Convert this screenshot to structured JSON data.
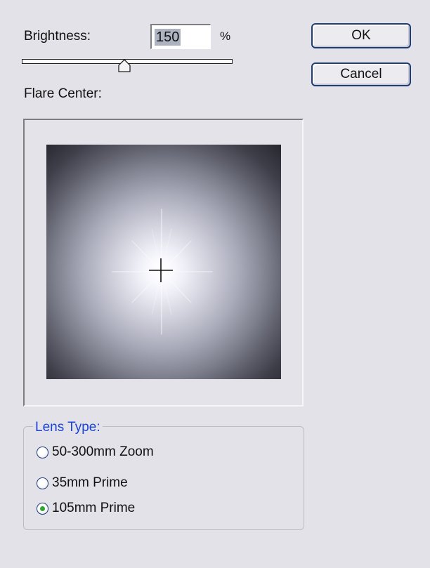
{
  "brightness": {
    "label": "Brightness:",
    "value": "150",
    "unit": "%",
    "slider_value": 150,
    "slider_min": 10,
    "slider_max": 300
  },
  "flare": {
    "label": "Flare Center:"
  },
  "buttons": {
    "ok": "OK",
    "cancel": "Cancel"
  },
  "lens": {
    "legend": "Lens Type:",
    "options": [
      {
        "label": "50-300mm Zoom",
        "selected": false
      },
      {
        "label": "35mm Prime",
        "selected": false
      },
      {
        "label": "105mm Prime",
        "selected": true
      }
    ]
  },
  "colors": {
    "background": "#e3e2e8",
    "button_border": "#1e3e78",
    "legend_text": "#1a43d8",
    "radio_dot": "#2fa62f"
  }
}
